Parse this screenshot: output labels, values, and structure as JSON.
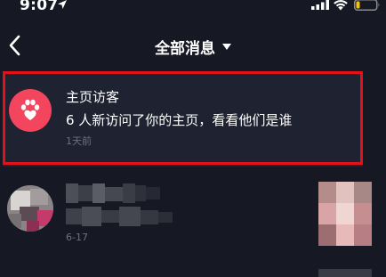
{
  "status_bar": {
    "time": "9:07",
    "icons": [
      "location-arrow-icon",
      "signal-icon",
      "wifi-icon",
      "battery-icon"
    ]
  },
  "nav": {
    "back_icon": "chevron-left-icon",
    "title": "全部消息",
    "dropdown_icon": "caret-down-icon"
  },
  "notification": {
    "icon": "paw-icon",
    "title": "主页访客",
    "body": "6 人新访问了你的主页，看看他们是谁",
    "time": "1天前",
    "highlight_color": "#e4101a",
    "avatar_color": "#f4455f"
  },
  "list": {
    "items": [
      {
        "date": "6-17"
      }
    ]
  },
  "colors": {
    "background": "#161823",
    "secondary_text": "#6e7080"
  }
}
